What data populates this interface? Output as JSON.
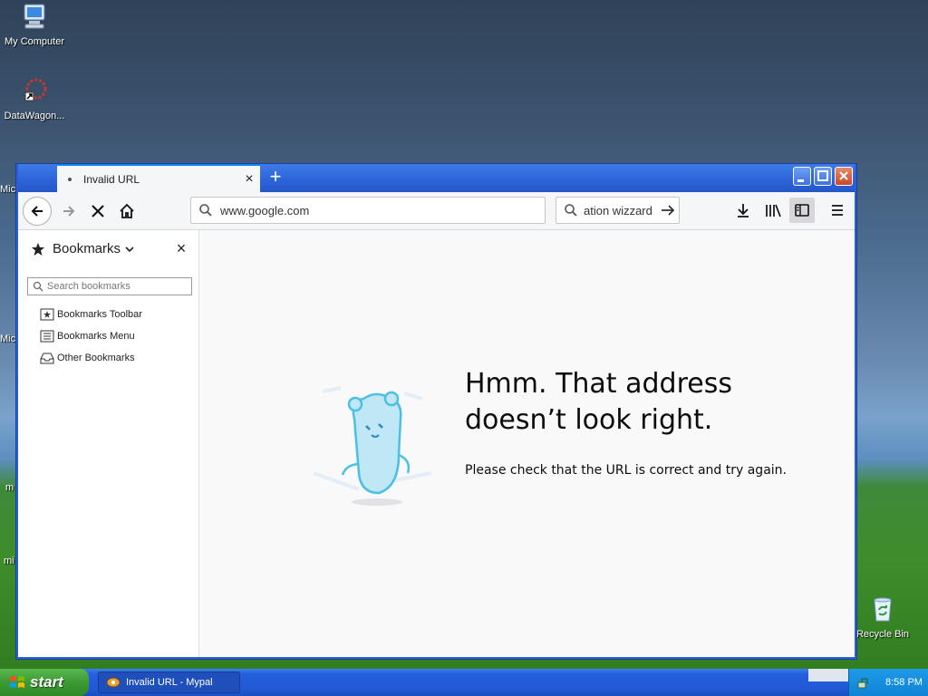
{
  "desktop": {
    "icons": [
      {
        "label": "My Computer",
        "icon": "my-computer-icon"
      },
      {
        "label": "DataWagon...",
        "icon": "datawagon-icon"
      },
      {
        "label": "Recycle Bin",
        "icon": "recycle-bin-icon"
      }
    ],
    "partial_labels": [
      "Mic",
      "Mic",
      "m",
      "mi"
    ]
  },
  "browser": {
    "tab": {
      "title": "Invalid URL",
      "close_label": "×"
    },
    "new_tab_label": "+",
    "window_buttons": {
      "minimize": "_",
      "maximize": "□",
      "close": "X"
    },
    "url": {
      "value": "www.google.com"
    },
    "search": {
      "value": "ation wizzard"
    },
    "sidebar": {
      "title": "Bookmarks",
      "close_label": "×",
      "search_placeholder": "Search bookmarks",
      "items": [
        {
          "label": "Bookmarks Toolbar",
          "icon": "bookmarks-toolbar-icon"
        },
        {
          "label": "Bookmarks Menu",
          "icon": "bookmarks-menu-icon"
        },
        {
          "label": "Other Bookmarks",
          "icon": "other-bookmarks-icon"
        }
      ]
    },
    "error": {
      "title": "Hmm. That address doesn’t look right.",
      "description": "Please check that the URL is correct and try again."
    }
  },
  "taskbar": {
    "start_label": "start",
    "task_label": "Invalid URL - Mypal",
    "clock": "8:58 PM"
  },
  "colors": {
    "accent": "#0a84ff",
    "taskbar": "#245edb",
    "start": "#3c9a34"
  }
}
